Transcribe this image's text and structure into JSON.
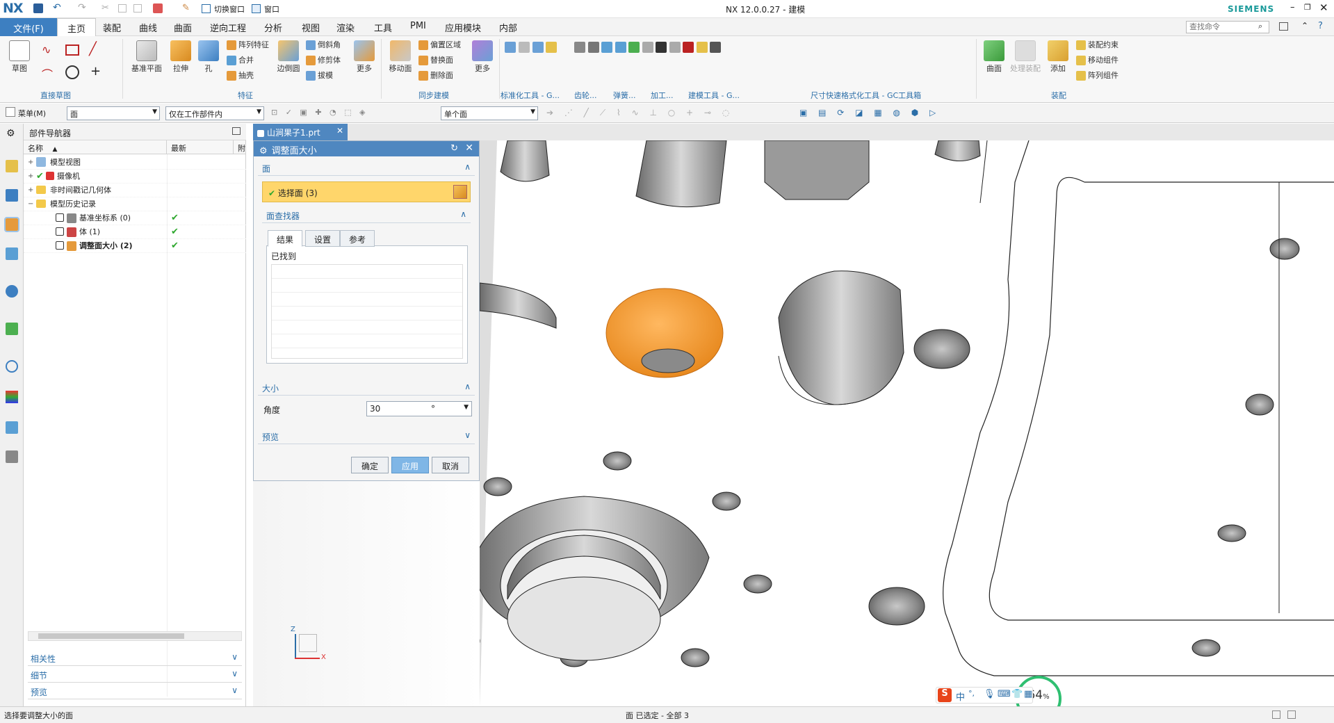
{
  "window": {
    "logo": "NX",
    "title": "NX 12.0.0.27 - 建模",
    "brand": "SIEMENS",
    "switch_window": "切换窗口",
    "window_menu": "窗口"
  },
  "menubar": {
    "file": "文件(F)",
    "tabs": [
      "主页",
      "装配",
      "曲线",
      "曲面",
      "逆向工程",
      "分析",
      "视图",
      "渲染",
      "工具",
      "PMI",
      "应用模块",
      "内部"
    ],
    "active_tab": "主页",
    "search_placeholder": "查找命令"
  },
  "ribbon": {
    "groups": {
      "sketch": "直接草图",
      "feature": "特征",
      "sync": "同步建模",
      "std_tool": "标准化工具 - G...",
      "gear": "齿轮...",
      "spring": "弹簧...",
      "machining": "加工...",
      "modeling_tool": "建模工具 - G...",
      "dim_tool": "尺寸快速格式化工具 - GC工具箱",
      "assembly": "装配"
    },
    "buttons": {
      "sketch": "草图",
      "datum_plane": "基准平面",
      "extrude": "拉伸",
      "hole": "孔",
      "pattern_feature": "阵列特征",
      "unite": "合并",
      "shell": "抽壳",
      "edge_blend": "边倒圆",
      "chamfer": "倒斜角",
      "trim_body": "修剪体",
      "draft": "拔模",
      "more1": "更多",
      "move_face": "移动面",
      "offset_region": "偏置区域",
      "replace_face": "替换面",
      "delete_face": "删除面",
      "more2": "更多",
      "surface": "曲面",
      "process_assembly": "处理装配",
      "add": "添加",
      "assembly_constraint": "装配约束",
      "move_component": "移动组件",
      "pattern_component": "阵列组件"
    }
  },
  "selbar": {
    "menu": "菜单(M)",
    "filter": "面",
    "scope": "仅在工作部件内",
    "mode": "单个面"
  },
  "navigator": {
    "title": "部件导航器",
    "columns": [
      "名称",
      "最新",
      "附"
    ],
    "rows": [
      {
        "label": "模型视图",
        "latest": ""
      },
      {
        "label": "摄像机",
        "latest": ""
      },
      {
        "label": "非时间戳记几何体",
        "latest": ""
      },
      {
        "label": "模型历史记录",
        "latest": ""
      },
      {
        "label": "基准坐标系 (0)",
        "latest": "✔"
      },
      {
        "label": "体 (1)",
        "latest": "✔"
      },
      {
        "label": "调整面大小 (2)",
        "latest": "✔"
      }
    ],
    "panels": [
      "相关性",
      "细节",
      "预览"
    ]
  },
  "doc_tab": {
    "name": "山涧果子1.prt"
  },
  "dialog": {
    "title": "调整面大小",
    "face_section": "面",
    "select_face": "选择面 (3)",
    "face_finder": "面查找器",
    "tabs": [
      "结果",
      "设置",
      "参考"
    ],
    "found_label": "已找到",
    "size_section": "大小",
    "angle_label": "角度",
    "angle_value": "30",
    "angle_unit": "°",
    "preview_section": "预览",
    "ok": "确定",
    "apply": "应用",
    "cancel": "取消"
  },
  "viewport": {
    "triad_z": "Z",
    "triad_x": "X",
    "zoom_badge": "64",
    "zoom_unit": "%",
    "ime": {
      "lang": "中",
      "punct": "°,"
    }
  },
  "status": {
    "prompt": "选择要调整大小的面",
    "selection": "面 已选定 - 全部 3"
  },
  "colors": {
    "accent": "#3d7fc1",
    "selected_face": "#f0a040",
    "select_row": "#ffd66b",
    "check": "#2fa82f"
  }
}
